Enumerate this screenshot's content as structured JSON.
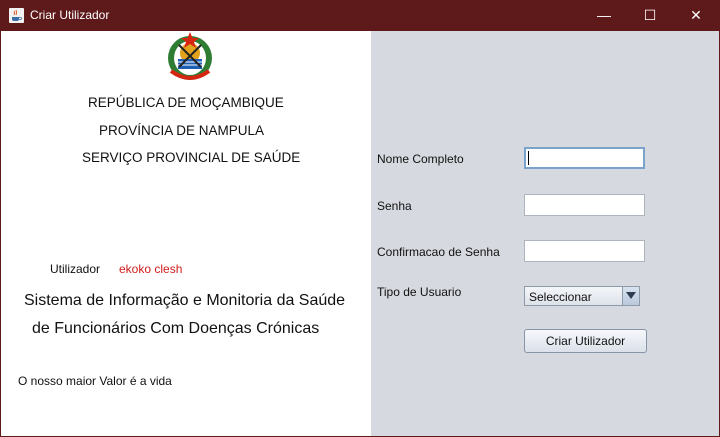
{
  "window": {
    "title": "Criar Utilizador",
    "controls": {
      "minimize": "—",
      "maximize": "☐",
      "close": "✕"
    }
  },
  "header": {
    "line1": "REPÚBLICA DE MOÇAMBIQUE",
    "line2": "PROVÍNCIA DE NAMPULA",
    "line3": "SERVIÇO PROVINCIAL DE SAÚDE"
  },
  "user": {
    "label": "Utilizador",
    "name": "ekoko clesh"
  },
  "system": {
    "title_line1": "Sistema de Informação e Monitoria da Saúde",
    "title_line2": "de Funcionários Com  Doenças Crónicas",
    "motto": "O nosso maior Valor é a vida"
  },
  "form": {
    "full_name_label": "Nome Completo",
    "full_name_value": "",
    "password_label": "Senha",
    "password_value": "",
    "confirm_label": "Confirmacao de Senha",
    "confirm_value": "",
    "user_type_label": "Tipo de Usuario",
    "user_type_selected": "Seleccionar",
    "submit_label": "Criar Utilizador"
  },
  "icons": {
    "app": "java-cup-icon",
    "emblem": "mozambique-coat-of-arms-icon"
  },
  "colors": {
    "titlebar": "#5e1a1a",
    "right_panel": "#d6d9df",
    "user_name": "#d21d1d"
  }
}
